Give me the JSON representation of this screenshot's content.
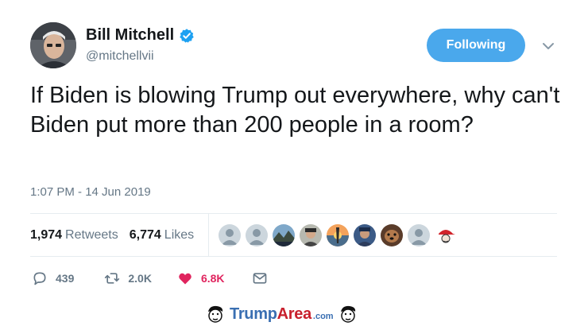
{
  "author": {
    "display_name": "Bill Mitchell",
    "handle": "@mitchellvii",
    "verified": true
  },
  "follow_button": {
    "label": "Following"
  },
  "tweet": {
    "text": "If Biden is blowing Trump out everywhere, why can't Biden put more than 200 people in a room?",
    "timestamp": "1:07 PM - 14 Jun 2019"
  },
  "stats": {
    "retweets": {
      "count": "1,974",
      "label": "Retweets"
    },
    "likes": {
      "count": "6,774",
      "label": "Likes"
    }
  },
  "likers": [
    {
      "icon": "default-avatar-icon"
    },
    {
      "icon": "default-avatar-icon"
    },
    {
      "icon": "landscape-avatar-icon"
    },
    {
      "icon": "person-avatar-icon"
    },
    {
      "icon": "sunset-avatar-icon"
    },
    {
      "icon": "person-avatar-icon"
    },
    {
      "icon": "dog-avatar-icon"
    },
    {
      "icon": "default-avatar-icon"
    },
    {
      "icon": "maga-hat-avatar-icon"
    }
  ],
  "actions": {
    "replies": "439",
    "retweets": "2.0K",
    "likes": "6.8K"
  },
  "watermark": {
    "brand_main": "Trump",
    "brand_accent": "Area",
    "brand_suffix": ".com"
  },
  "colors": {
    "accent_blue": "#4aa8ec",
    "like_red": "#e0245e",
    "muted_text": "#657786",
    "verified_blue": "#1da1f2"
  }
}
